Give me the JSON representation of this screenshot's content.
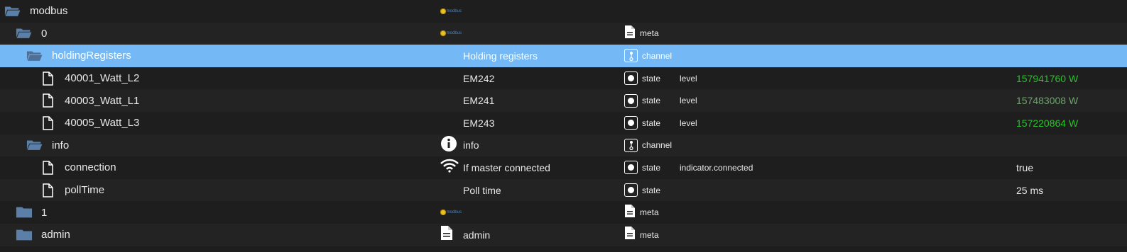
{
  "colors": {
    "background": "#1e1e1e",
    "selected_row": "#74b9f5",
    "folder_icon": "#5b7fa6",
    "value_green": "#2bc12b"
  },
  "rows": [
    {
      "name": "modbus",
      "desc": "",
      "type": "",
      "role": "",
      "value": ""
    },
    {
      "name": "0",
      "desc": "",
      "type": "meta",
      "role": "",
      "value": ""
    },
    {
      "name": "holdingRegisters",
      "desc": "Holding registers",
      "type": "channel",
      "role": "",
      "value": ""
    },
    {
      "name": "40001_Watt_L2",
      "desc": "EM242",
      "type": "state",
      "role": "level",
      "value": "157941760 W"
    },
    {
      "name": "40003_Watt_L1",
      "desc": "EM241",
      "type": "state",
      "role": "level",
      "value": "157483008 W"
    },
    {
      "name": "40005_Watt_L3",
      "desc": "EM243",
      "type": "state",
      "role": "level",
      "value": "157220864 W"
    },
    {
      "name": "info",
      "desc": "info",
      "type": "channel",
      "role": "",
      "value": ""
    },
    {
      "name": "connection",
      "desc": "If master connected",
      "type": "state",
      "role": "indicator.connected",
      "value": "true"
    },
    {
      "name": "pollTime",
      "desc": "Poll time",
      "type": "state",
      "role": "",
      "value": "25 ms"
    },
    {
      "name": "1",
      "desc": "",
      "type": "meta",
      "role": "",
      "value": ""
    },
    {
      "name": "admin",
      "desc": "admin",
      "type": "meta",
      "role": "",
      "value": ""
    }
  ]
}
